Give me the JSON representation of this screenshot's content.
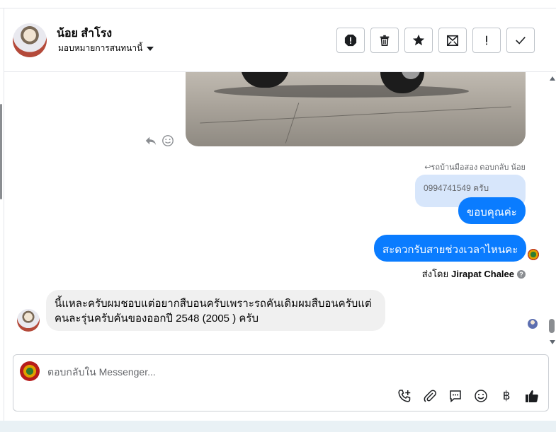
{
  "header": {
    "contact_name": "น้อย สำโรง",
    "assigned_label": "มอบหมายการสนทนานี้",
    "actions": [
      {
        "name": "spam-icon",
        "label": "Mark as spam"
      },
      {
        "name": "trash-icon",
        "label": "Delete"
      },
      {
        "name": "star-icon",
        "label": "Star"
      },
      {
        "name": "mark-unread-icon",
        "label": "Mark as unread"
      },
      {
        "name": "follow-up-icon",
        "label": "Follow up"
      },
      {
        "name": "done-icon",
        "label": "Mark as done"
      }
    ]
  },
  "conversation": {
    "reply_meta": "↩รถบ้านมือสอง ตอบกลับ น้อย",
    "quoted_text": "0994741549 ครับ",
    "outgoing": [
      {
        "text": "ขอบคุณค่ะ"
      },
      {
        "text": "สะดวกรับสายช่วงเวลาไหนคะ"
      }
    ],
    "sent_by_prefix": "ส่งโดย",
    "sent_by_name": "Jirapat Chalee",
    "incoming": {
      "line1": "นี้แหละครับผมชอบแต่อยากสืบอนครับเพราะรถคันเดิมผมสืบอนครับแต่",
      "line2": "คนละรุ่นครับคันของออกปี 2548 (2005 ) ครับ"
    }
  },
  "composer": {
    "placeholder": "ตอบกลับใน Messenger...",
    "currency_symbol": "฿",
    "tools": [
      "call-add-icon",
      "attachment-icon",
      "saved-replies-icon",
      "emoji-icon",
      "payment-icon",
      "like-icon"
    ]
  },
  "colors": {
    "accent": "#0a7cff",
    "quoted_bg": "#d7e6fb",
    "incoming_bg": "#f0f0f0"
  }
}
